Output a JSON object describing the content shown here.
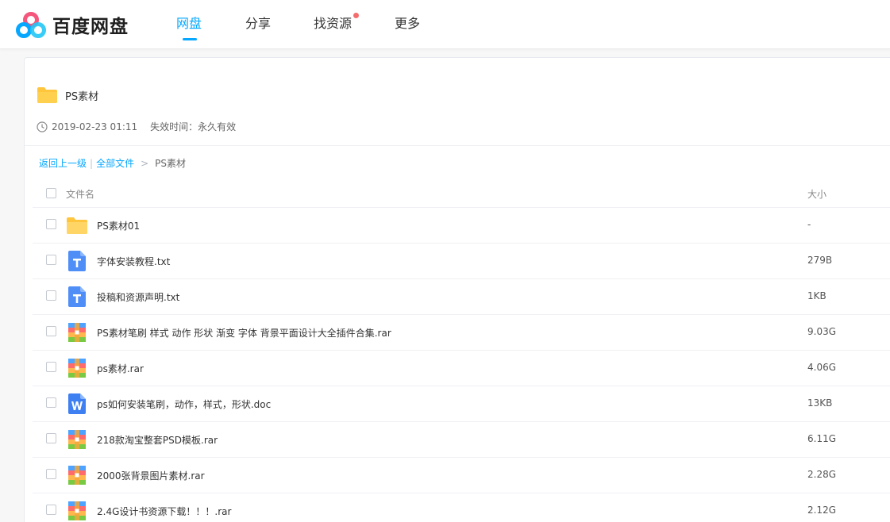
{
  "app": {
    "logo_text": "百度网盘",
    "nav": [
      {
        "label": "网盘",
        "active": true
      },
      {
        "label": "分享",
        "active": false
      },
      {
        "label": "找资源",
        "active": false,
        "badge_dot": true
      },
      {
        "label": "更多",
        "active": false
      }
    ]
  },
  "share": {
    "folder_name": "PS素材",
    "time": "2019-02-23 01:11",
    "expire": "失效时间：永久有效"
  },
  "breadcrumb": {
    "back": "返回上一级",
    "sep": "|",
    "all_files": "全部文件",
    "arrow": ">",
    "current": "PS素材"
  },
  "table": {
    "col_name": "文件名",
    "col_size": "大小",
    "rows": [
      {
        "name": "PS素材01",
        "size": "-",
        "icon": "folder-icon"
      },
      {
        "name": "字体安装教程.txt",
        "size": "279B",
        "icon": "txt-file-icon"
      },
      {
        "name": "投稿和资源声明.txt",
        "size": "1KB",
        "icon": "txt-file-icon"
      },
      {
        "name": "PS素材笔刷 样式 动作 形状 渐变 字体 背景平面设计大全插件合集.rar",
        "size": "9.03G",
        "icon": "rar-file-icon"
      },
      {
        "name": "ps素材.rar",
        "size": "4.06G",
        "icon": "rar-file-icon"
      },
      {
        "name": "ps如何安装笔刷，动作，样式，形状.doc",
        "size": "13KB",
        "icon": "doc-file-icon"
      },
      {
        "name": "218款淘宝整套PSD模板.rar",
        "size": "6.11G",
        "icon": "rar-file-icon"
      },
      {
        "name": "2000张背景图片素材.rar",
        "size": "2.28G",
        "icon": "rar-file-icon"
      },
      {
        "name": "2.4G设计书资源下载！！！.rar",
        "size": "2.12G",
        "icon": "rar-file-icon"
      }
    ]
  },
  "colors": {
    "accent": "#06a7ff",
    "folder": "#ffc53d",
    "badge": "#f56c6c"
  }
}
